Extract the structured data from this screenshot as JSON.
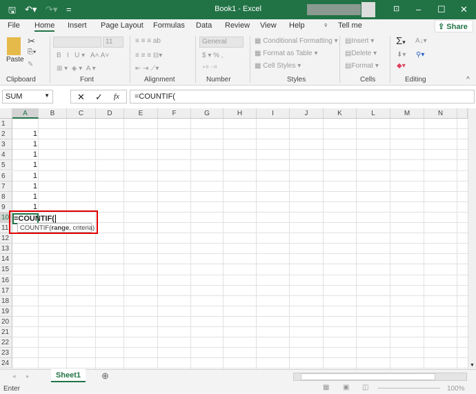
{
  "title": "Book1 - Excel",
  "tabs": [
    "File",
    "Home",
    "Insert",
    "Page Layout",
    "Formulas",
    "Data",
    "Review",
    "View",
    "Help"
  ],
  "tell_me": "Tell me",
  "share": "Share",
  "ribbon": {
    "clipboard": {
      "label": "Clipboard",
      "paste": "Paste"
    },
    "font": {
      "label": "Font",
      "size": "11"
    },
    "alignment": {
      "label": "Alignment"
    },
    "number": {
      "label": "Number",
      "format": "General"
    },
    "styles": {
      "label": "Styles",
      "conditional": "Conditional Formatting",
      "format_table": "Format as Table",
      "cell_styles": "Cell Styles"
    },
    "cells": {
      "label": "Cells",
      "insert": "Insert",
      "delete": "Delete",
      "format": "Format"
    },
    "editing": {
      "label": "Editing"
    }
  },
  "name_box": "SUM",
  "formula": "=COUNTIF(",
  "columns": [
    "A",
    "B",
    "C",
    "D",
    "E",
    "F",
    "G",
    "H",
    "I",
    "J",
    "K",
    "L",
    "M",
    "N"
  ],
  "rows": [
    "1",
    "2",
    "3",
    "4",
    "5",
    "6",
    "7",
    "8",
    "9",
    "10",
    "11",
    "12",
    "13",
    "14",
    "15",
    "16",
    "17",
    "18",
    "19",
    "20",
    "21",
    "22",
    "23",
    "24"
  ],
  "cells": {
    "A2": "1",
    "A3": "1",
    "A4": "1",
    "A5": "1",
    "A6": "1",
    "A7": "1",
    "A8": "1",
    "A9": "1",
    "A10": "=COUNTIF("
  },
  "tooltip": {
    "fn": "COUNTIF(",
    "arg1": "range",
    ",rest": ", criteria)"
  },
  "sheet": "Sheet1",
  "status": "Enter",
  "zoom": "100%",
  "colors": {
    "accent": "#217346",
    "highlight": "#e00000"
  }
}
